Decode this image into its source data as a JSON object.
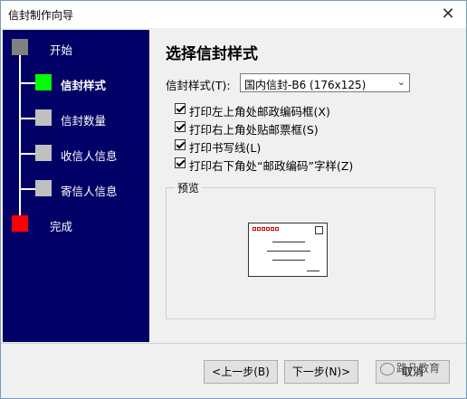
{
  "window": {
    "title": "信封制作向导"
  },
  "steps": [
    {
      "label": "开始",
      "color": "#808080"
    },
    {
      "label": "信封样式",
      "color": "#00ff00"
    },
    {
      "label": "信封数量",
      "color": "#c0c0c0"
    },
    {
      "label": "收信人信息",
      "color": "#c0c0c0"
    },
    {
      "label": "寄信人信息",
      "color": "#c0c0c0"
    },
    {
      "label": "完成",
      "color": "#ff0000"
    }
  ],
  "main": {
    "heading": "选择信封样式",
    "style_label": "信封样式(T):",
    "style_value": "国内信封-B6 (176x125)",
    "options": [
      {
        "label": "打印左上角处邮政编码框(X)",
        "checked": true
      },
      {
        "label": "打印右上角处贴邮票框(S)",
        "checked": true
      },
      {
        "label": "打印书写线(L)",
        "checked": true
      },
      {
        "label": "打印右下角处“邮政编码”字样(Z)",
        "checked": true
      }
    ],
    "preview_label": "预览"
  },
  "buttons": {
    "back": "<上一步(B)",
    "next": "下一步(N)>",
    "cancel": "取消"
  },
  "watermark": "路凡教育",
  "colors": {
    "left_panel": "#000066",
    "zip_box": "#cc0000"
  }
}
